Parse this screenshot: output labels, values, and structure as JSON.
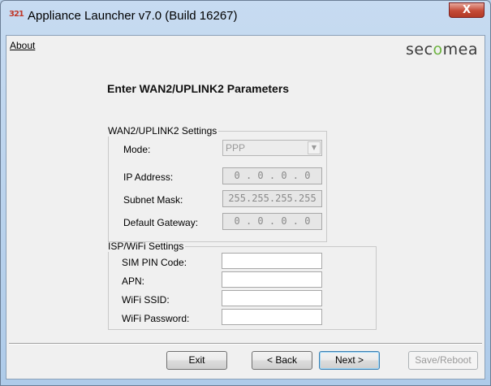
{
  "window": {
    "icon_text": "321",
    "title": "Appliance Launcher v7.0 (Build 16267)",
    "close_symbol": "X"
  },
  "menu": {
    "about": "About"
  },
  "logo": {
    "prefix": "sec",
    "o": "o",
    "suffix": "mea",
    "accent_color": "#6cb33f"
  },
  "heading": "Enter WAN2/UPLINK2 Parameters",
  "wan_settings": {
    "legend": "WAN2/UPLINK2 Settings",
    "mode": {
      "label": "Mode:",
      "value": "PPP"
    },
    "ip_address": {
      "label": "IP Address:",
      "value": "0 . 0 . 0 . 0"
    },
    "subnet_mask": {
      "label": "Subnet Mask:",
      "value": "255.255.255.255"
    },
    "default_gateway": {
      "label": "Default Gateway:",
      "value": "0 . 0 . 0 . 0"
    }
  },
  "isp_settings": {
    "legend": "ISP/WiFi Settings",
    "sim_pin": {
      "label": "SIM PIN Code:",
      "value": ""
    },
    "apn": {
      "label": "APN:",
      "value": ""
    },
    "wifi_ssid": {
      "label": "WiFi SSID:",
      "value": ""
    },
    "wifi_password": {
      "label": "WiFi Password:",
      "value": ""
    }
  },
  "buttons": {
    "exit": "Exit",
    "back": "< Back",
    "next": "Next >",
    "save_reboot": "Save/Reboot"
  }
}
